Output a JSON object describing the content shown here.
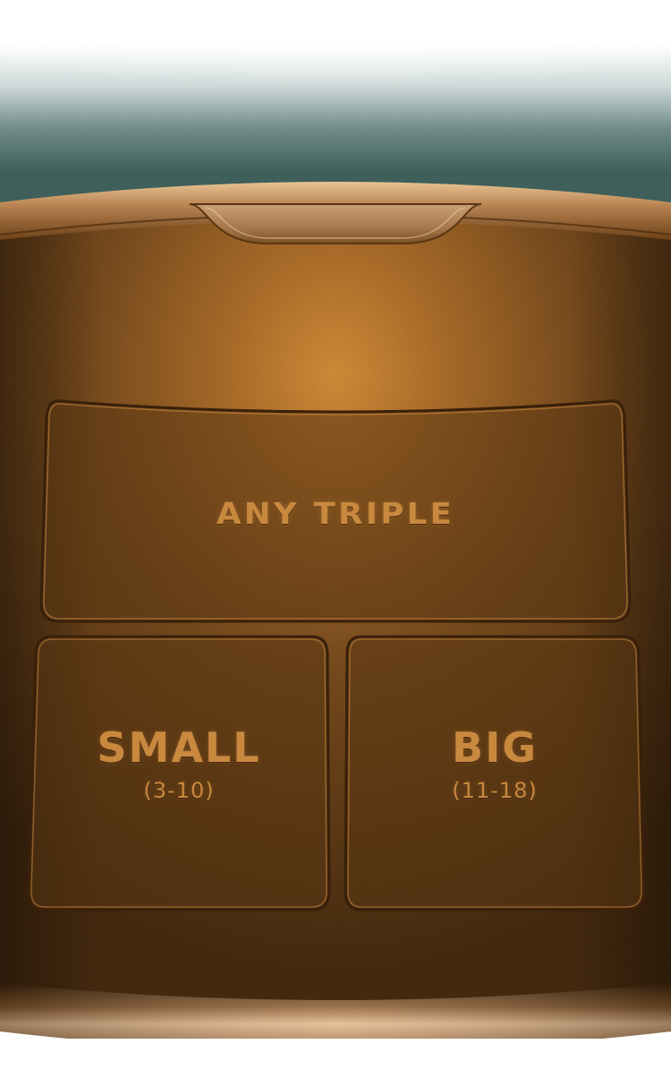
{
  "bets": {
    "any_triple": {
      "label": "ANY TRIPLE"
    },
    "small": {
      "label": "SMALL",
      "range": "(3-10)"
    },
    "big": {
      "label": "BIG",
      "range": "(11-18)"
    }
  },
  "colors": {
    "felt_teal": "#3e5f5a",
    "table_brown": "#6e4318",
    "glow_orange": "#d98e38",
    "label_gold": "#c8893f",
    "rim_bronze": "#b8865a"
  }
}
